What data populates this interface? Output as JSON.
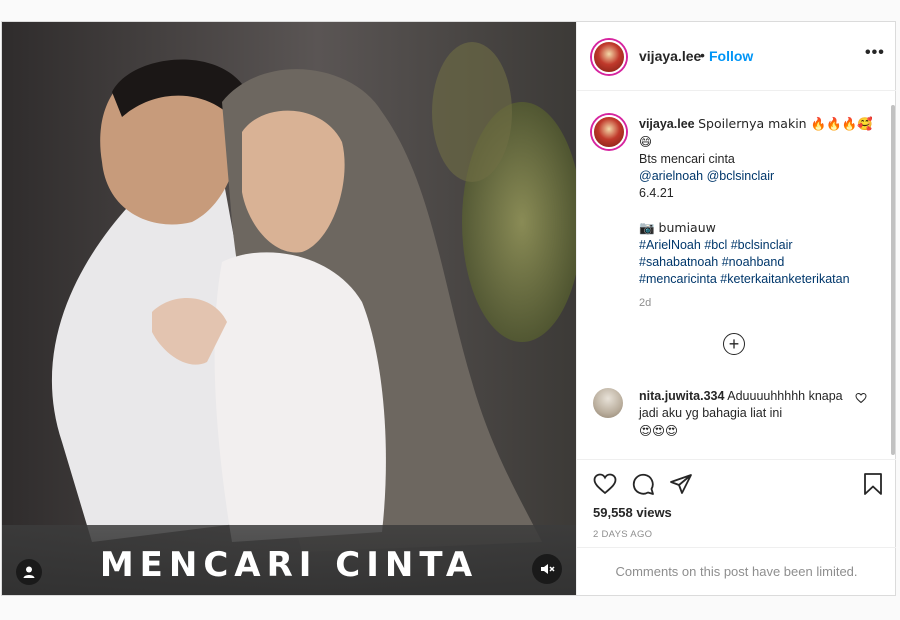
{
  "post": {
    "username": "vijaya.lee",
    "follow_label": "Follow",
    "separator": "•",
    "more_label": "•••",
    "media_caption": "MENCARI CINTA"
  },
  "caption": {
    "username": "vijaya.lee",
    "text_line1": "Spoilernya makin 🔥🔥🔥🥰",
    "text_line2": "😄",
    "line3": "Bts mencari cinta",
    "mention1": "@arielnoah",
    "mention2": "@bclsinclair",
    "date": "6.4.21",
    "location_line": "📷 bumiauw",
    "hashtags_line1": "#ArielNoah #bcl #bclsinclair",
    "hashtags_line2": "#sahabatnoah #noahband",
    "hashtags_line3": "#mencaricinta #keterkaitanketerikatan",
    "time": "2d"
  },
  "comment": {
    "username": "nita.juwita.334",
    "text": "Aduuuuhhhhh knapa jadi aku yg bahagia liat ini",
    "emojis": "😍😍😍"
  },
  "stats": {
    "views": "59,558 views",
    "ago": "2 DAYS AGO",
    "comments_limited": "Comments on this post have been limited."
  },
  "icons": {
    "like": "heart-icon",
    "comment": "comment-icon",
    "share": "share-icon",
    "save": "bookmark-icon",
    "load_more": "plus-circle-icon",
    "tagged_user": "user-icon",
    "mute": "muted-speaker-icon"
  }
}
